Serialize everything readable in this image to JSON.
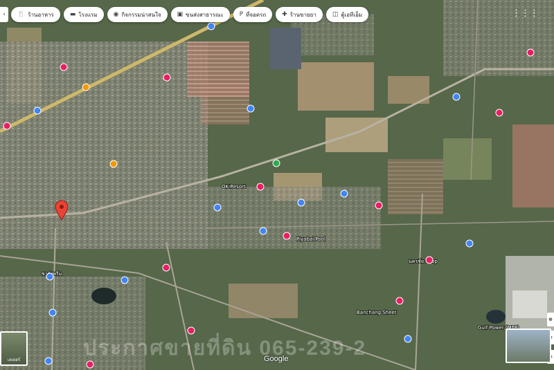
{
  "chips": [
    {
      "icon": "restaurant-icon",
      "glyph": "🍴",
      "label": "ร้านอาหาร"
    },
    {
      "icon": "hotel-icon",
      "glyph": "▬",
      "label": "โรงแรม"
    },
    {
      "icon": "camera-icon",
      "glyph": "◉",
      "label": "กิจกรรมน่าสนใจ"
    },
    {
      "icon": "bus-icon",
      "glyph": "▣",
      "label": "ขนส่งสาธารณะ"
    },
    {
      "icon": "parking-icon",
      "glyph": "P",
      "label": "ที่จอดรถ"
    },
    {
      "icon": "pharmacy-icon",
      "glyph": "✚",
      "label": "ร้านขายยา"
    },
    {
      "icon": "atm-icon",
      "glyph": "◫",
      "label": "ตู้เอทีเอ็ม"
    }
  ],
  "map_labels": {
    "resort": "OK Resort",
    "pool": "Piyabai Pool",
    "village": "ซาลังพรีม",
    "banchang": "Banchang Sheet",
    "power": "Gulf Power (MTP)",
    "station": "นครชัย Shop"
  },
  "layers_label": "เลเยอร์",
  "google_logo": "Google",
  "watermark": "ประกาศขายที่ดิน 065-239-2",
  "colors": {
    "pin_red": "#ea4335",
    "poi_pink": "#e91e63",
    "poi_orange": "#f29900",
    "poi_blue": "#4285f4",
    "poi_green": "#34a853"
  }
}
